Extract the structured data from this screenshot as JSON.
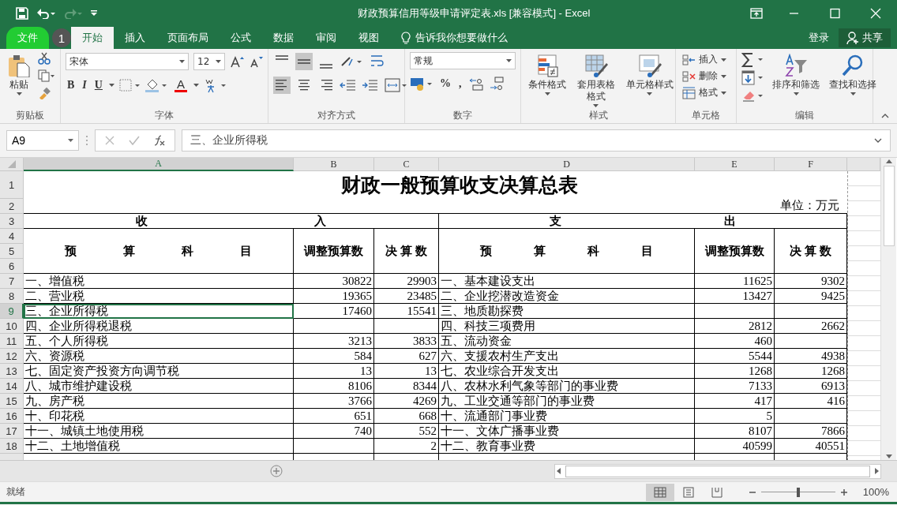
{
  "window": {
    "title": "财政预算信用等级申请评定表.xls  [兼容模式] - Excel",
    "redo_disabled": true
  },
  "tabs": [
    {
      "label": "文件",
      "kind": "file",
      "selected": false
    },
    {
      "label": "开始",
      "kind": "tab",
      "selected": true
    },
    {
      "label": "插入",
      "kind": "tab",
      "selected": false
    },
    {
      "label": "页面布局",
      "kind": "tab",
      "selected": false
    },
    {
      "label": "公式",
      "kind": "tab",
      "selected": false
    },
    {
      "label": "数据",
      "kind": "tab",
      "selected": false
    },
    {
      "label": "审阅",
      "kind": "tab",
      "selected": false
    },
    {
      "label": "视图",
      "kind": "tab",
      "selected": false
    }
  ],
  "tell_me": {
    "placeholder": "告诉我你想要做什么"
  },
  "step_badge": "1",
  "account": {
    "sign_in": "登录",
    "share": "共享"
  },
  "ribbon": {
    "clipboard": {
      "paste": "粘贴",
      "label": "剪贴板"
    },
    "font": {
      "name": "宋体",
      "size": "12",
      "bold": "B",
      "italic": "I",
      "underline": "U",
      "font_color": "A",
      "label": "字体"
    },
    "alignment": {
      "label": "对齐方式"
    },
    "number": {
      "format": "常规",
      "percent": "%",
      "comma": ",",
      "label": "数字"
    },
    "styles": {
      "buttons": [
        "条件格式",
        "套用表格格式",
        "单元格样式"
      ],
      "label": "样式"
    },
    "cells": {
      "buttons": [
        "插入",
        "删除",
        "格式"
      ],
      "label": "单元格"
    },
    "editing": {
      "buttons": [
        "排序和筛选",
        "查找和选择"
      ],
      "label": "编辑"
    }
  },
  "formula_bar": {
    "name_box": "A9",
    "formula": "三、企业所得税"
  },
  "sheet": {
    "columns": [
      {
        "label": "A",
        "selected": true
      },
      {
        "label": "B",
        "selected": false
      },
      {
        "label": "C",
        "selected": false
      },
      {
        "label": "D",
        "selected": false
      },
      {
        "label": "E",
        "selected": false
      },
      {
        "label": "F",
        "selected": false
      }
    ],
    "row_numbers": [
      "1",
      "2",
      "3",
      "4",
      "5",
      "6"
    ],
    "title": "财政一般预算收支决算总表",
    "unit": "单位：万元",
    "sections": [
      [
        "收",
        "入"
      ],
      [
        "支",
        "出"
      ]
    ],
    "headers": [
      [
        "预",
        "算",
        "科",
        "目"
      ],
      "调整预算数",
      "决 算 数",
      [
        "预",
        "算",
        "科",
        "目"
      ],
      "调整预算数",
      "决 算 数"
    ],
    "rows": [
      {
        "number": "7",
        "selected": false,
        "cells": [
          "一、增值税",
          "30822",
          "29903",
          "一、基本建设支出",
          "11625",
          "9302"
        ]
      },
      {
        "number": "8",
        "selected": false,
        "cells": [
          "二、营业税",
          "19365",
          "23485",
          "二、企业挖潜改造资金",
          "13427",
          "9425"
        ]
      },
      {
        "number": "9",
        "selected": true,
        "cells": [
          "三、企业所得税",
          "17460",
          "15541",
          "三、地质勘探费",
          null,
          null
        ]
      },
      {
        "number": "10",
        "selected": false,
        "cells": [
          "四、企业所得税退税",
          null,
          null,
          "四、科技三项费用",
          "2812",
          "2662"
        ]
      },
      {
        "number": "11",
        "selected": false,
        "cells": [
          "五、个人所得税",
          "3213",
          "3833",
          "五、流动资金",
          "460",
          null
        ]
      },
      {
        "number": "12",
        "selected": false,
        "cells": [
          "六、资源税",
          "584",
          "627",
          "六、支援农村生产支出",
          "5544",
          "4938"
        ]
      },
      {
        "number": "13",
        "selected": false,
        "cells": [
          "七、固定资产投资方向调节税",
          "13",
          "13",
          "七、农业综合开发支出",
          "1268",
          "1268"
        ]
      },
      {
        "number": "14",
        "selected": false,
        "cells": [
          "八、城市维护建设税",
          "8106",
          "8344",
          "八、农林水利气象等部门的事业费",
          "7133",
          "6913"
        ]
      },
      {
        "number": "15",
        "selected": false,
        "cells": [
          "九、房产税",
          "3766",
          "4269",
          "九、工业交通等部门的事业费",
          "417",
          "416"
        ]
      },
      {
        "number": "16",
        "selected": false,
        "cells": [
          "十、印花税",
          "651",
          "668",
          "十、流通部门事业费",
          "5",
          null
        ]
      },
      {
        "number": "17",
        "selected": false,
        "cells": [
          "十一、城镇土地使用税",
          "740",
          "552",
          "十一、文体广播事业费",
          "8107",
          "7866"
        ]
      },
      {
        "number": "18",
        "selected": false,
        "cells": [
          "十二、土地增值税",
          null,
          "2",
          "十二、教育事业费",
          "40599",
          "40551"
        ]
      }
    ]
  },
  "status_bar": {
    "status": "就绪",
    "zoom": "100%",
    "level": 0.5,
    "views": [
      {
        "kind": "normal",
        "selected": true
      },
      {
        "kind": "layout",
        "selected": false
      },
      {
        "kind": "break",
        "selected": false
      }
    ]
  }
}
